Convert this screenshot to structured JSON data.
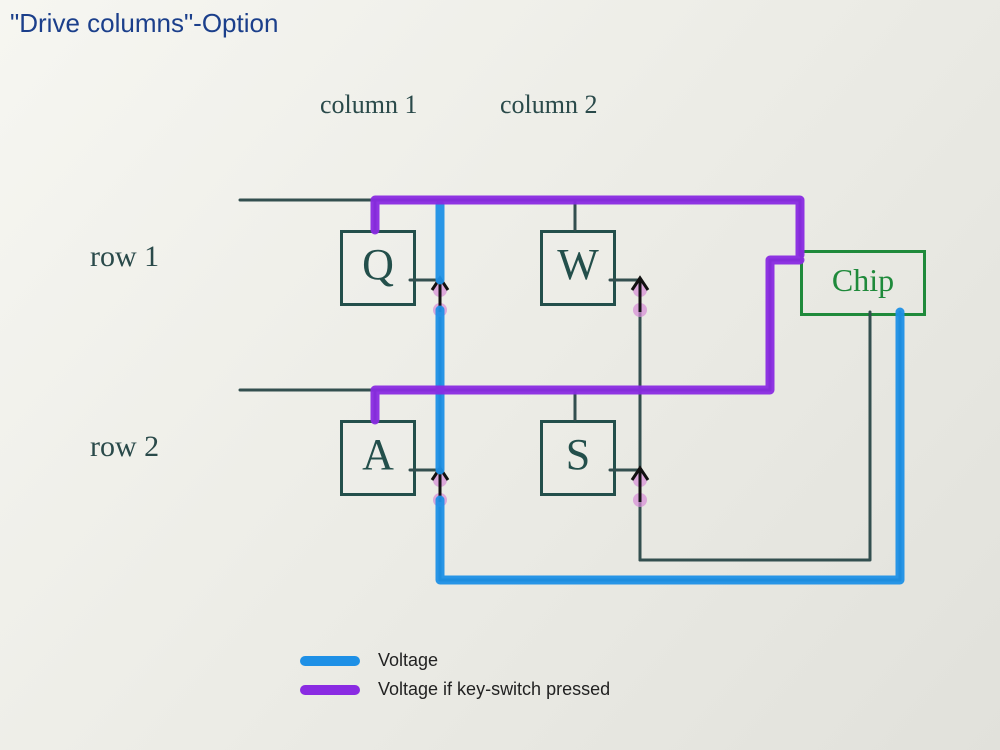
{
  "title": "\"Drive columns\"-Option",
  "columns": {
    "col1": "column 1",
    "col2": "column 2"
  },
  "rows": {
    "row1": "row 1",
    "row2": "row 2"
  },
  "keys": {
    "q": "Q",
    "w": "W",
    "a": "A",
    "s": "S"
  },
  "chip": "Chip",
  "legend": {
    "voltage": "Voltage",
    "voltage_pressed": "Voltage if key-switch pressed"
  },
  "colors": {
    "voltage": "#1e90e6",
    "voltage_pressed": "#8a2be2",
    "pen": "#334f4f",
    "chip": "#1f8a3b"
  }
}
